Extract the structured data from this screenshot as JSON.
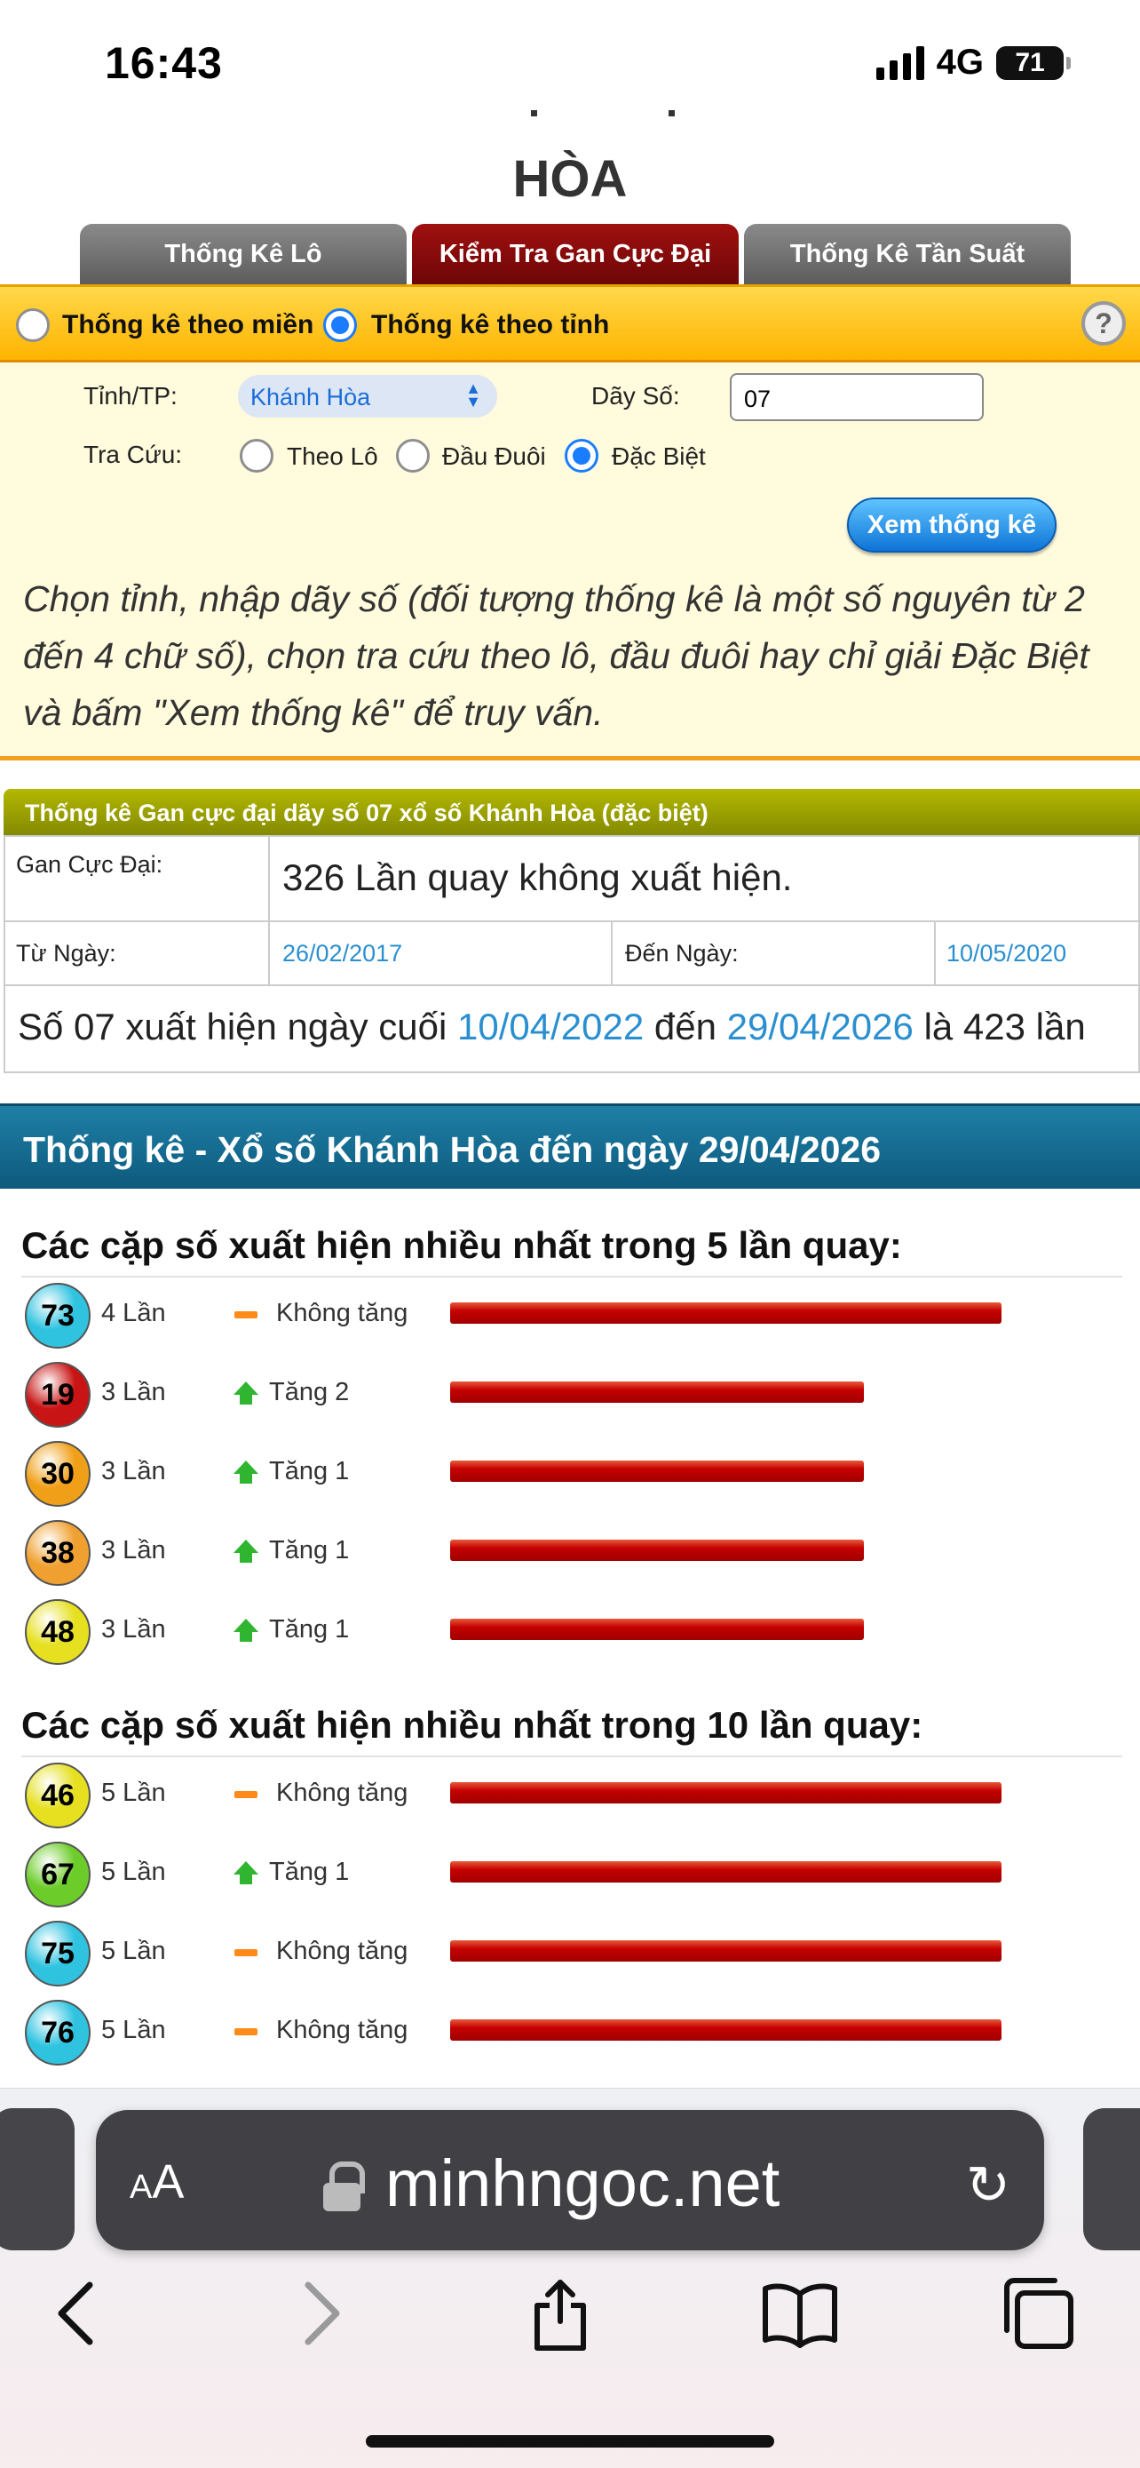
{
  "status_bar": {
    "time": "16:43",
    "network": "4G",
    "battery": "71"
  },
  "header": {
    "title": "HÒA"
  },
  "tabs": [
    {
      "label": "Thống Kê Lô"
    },
    {
      "label": "Kiểm Tra Gan Cực Đại"
    },
    {
      "label": "Thống Kê Tần Suất"
    }
  ],
  "options": {
    "by_region": "Thống kê theo miền",
    "by_province": "Thống kê theo tỉnh",
    "help": "?"
  },
  "form": {
    "province_label": "Tỉnh/TP:",
    "province_value": "Khánh Hòa",
    "number_label": "Dãy Số:",
    "number_value": "07",
    "lookup_label": "Tra Cứu:",
    "lookup_options": [
      "Theo Lô",
      "Đầu Đuôi",
      "Đặc Biệt"
    ],
    "submit_label": "Xem thống kê",
    "instructions": "Chọn tỉnh, nhập dãy số (đối tượng thống kê là một số nguyên từ 2 đến 4 chữ số), chọn tra cứu theo lô, đầu đuôi hay chỉ giải Đặc Biệt và bấm \"Xem thống kê\" để truy vấn."
  },
  "gan": {
    "heading": "Thống kê Gan cực đại dãy số 07 xổ số Khánh Hòa (đặc biệt)",
    "max_label": "Gan Cực Đại:",
    "max_value": "326 Lần quay không xuất hiện.",
    "from_label": "Từ Ngày:",
    "from_value": "26/02/2017",
    "to_label": "Đến Ngày:",
    "to_value": "10/05/2020",
    "last_prefix": "Số 07 xuất hiện ngày cuối",
    "last_date": "10/04/2022",
    "last_mid": "đến",
    "last_end_date": "29/04/2026",
    "last_suffix": "là 423 lần"
  },
  "stats": {
    "heading": "Thống kê - Xổ số Khánh Hòa đến ngày 29/04/2026",
    "section5": {
      "title": "Các cặp số xuất hiện nhiều nhất trong 5 lần quay:",
      "rows": [
        {
          "number": "73",
          "times": "4 Lần",
          "trend": "Không tăng",
          "count": 4,
          "color": "#2fc3e0"
        },
        {
          "number": "19",
          "times": "3 Lần",
          "trend": "Tăng 2",
          "count": 3,
          "color": "#c81414"
        },
        {
          "number": "30",
          "times": "3 Lần",
          "trend": "Tăng 1",
          "count": 3,
          "color": "#f0a018"
        },
        {
          "number": "38",
          "times": "3 Lần",
          "trend": "Tăng 1",
          "count": 3,
          "color": "#f0a030"
        },
        {
          "number": "48",
          "times": "3 Lần",
          "trend": "Tăng 1",
          "count": 3,
          "color": "#e6e020"
        }
      ]
    },
    "section10": {
      "title": "Các cặp số xuất hiện nhiều nhất trong 10 lần quay:",
      "rows": [
        {
          "number": "46",
          "times": "5 Lần",
          "trend": "Không tăng",
          "count": 5,
          "color": "#e6e020"
        },
        {
          "number": "67",
          "times": "5 Lần",
          "trend": "Tăng 1",
          "count": 5,
          "color": "#6ccc2a"
        },
        {
          "number": "75",
          "times": "5 Lần",
          "trend": "Không tăng",
          "count": 5,
          "color": "#2fc3e0"
        },
        {
          "number": "76",
          "times": "5 Lần",
          "trend": "Không tăng",
          "count": 5,
          "color": "#2fc3e0"
        }
      ]
    }
  },
  "browser": {
    "text_size": "AA",
    "url": "minhngoc.net"
  }
}
